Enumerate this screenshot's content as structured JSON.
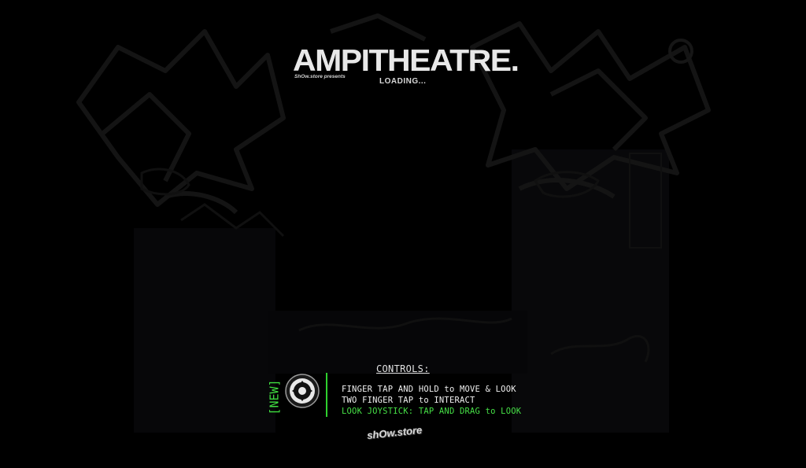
{
  "header": {
    "title": "AMPITHEATRE.",
    "presents": "ShOw.store presents",
    "status": "LOADING..."
  },
  "controls": {
    "heading": "CONTROLS:",
    "new_badge": "[NEW]",
    "joystick_icon": "joystick-icon",
    "lines": [
      "FINGER TAP AND HOLD to MOVE & LOOK",
      "TWO FINGER TAP to INTERACT",
      "LOOK JOYSTICK: TAP AND DRAG to LOOK"
    ],
    "accent_color": "#46e046"
  },
  "footer": {
    "logo_text": "shOw.store"
  }
}
